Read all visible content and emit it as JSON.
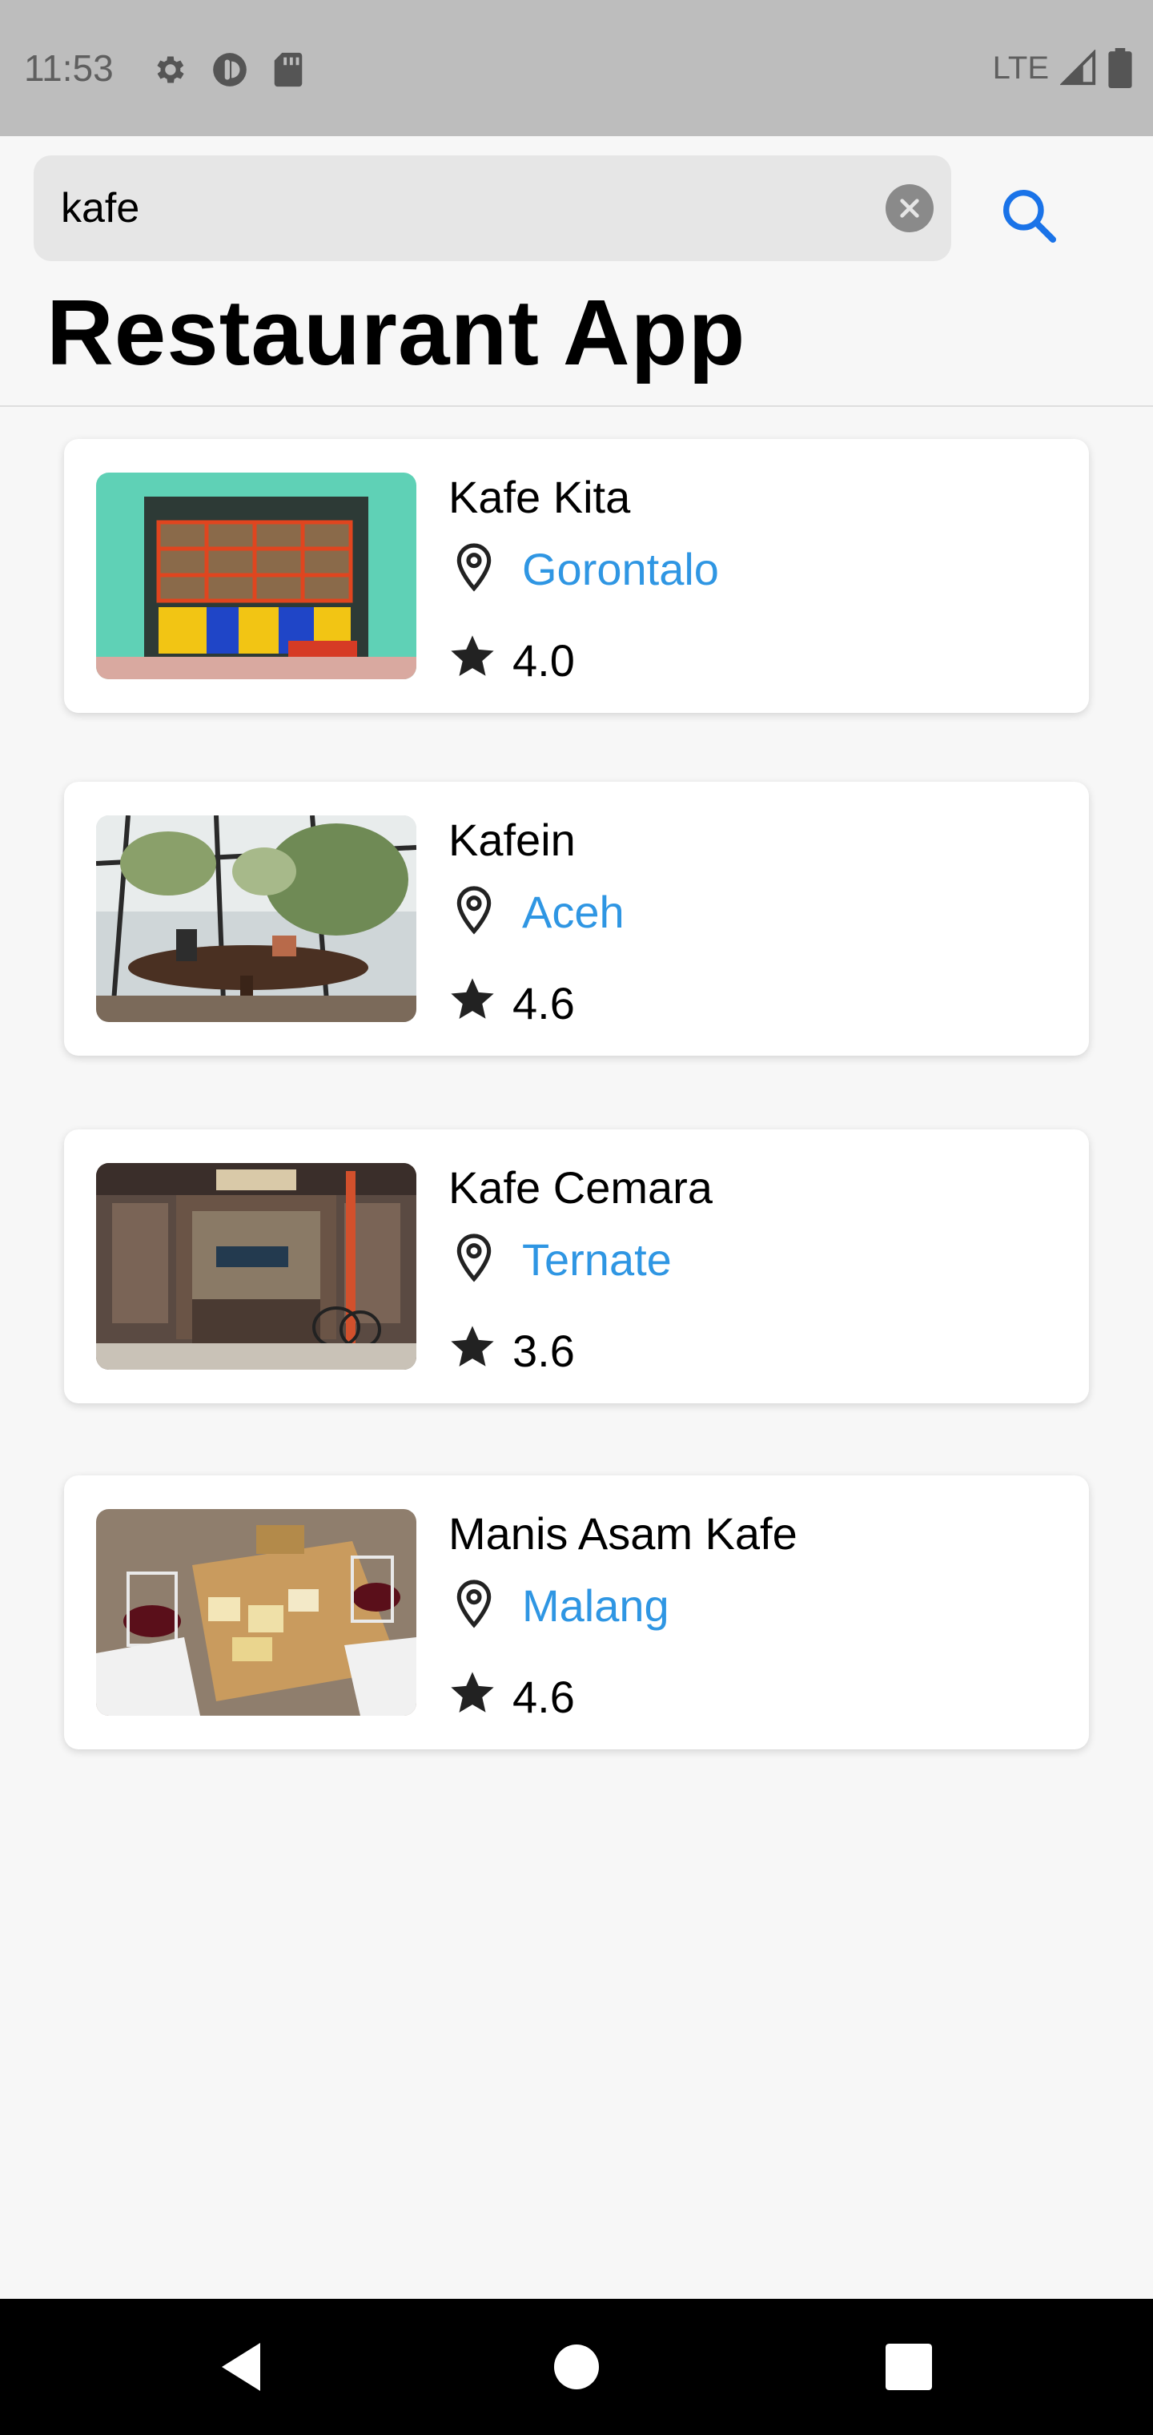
{
  "status_bar": {
    "time": "11:53",
    "network": "LTE",
    "icons": [
      "settings-icon",
      "vpn-key-icon",
      "sd-card-icon",
      "signal-icon",
      "battery-icon"
    ]
  },
  "search": {
    "query": "kafe",
    "clear_icon": "close-circle-icon",
    "search_icon": "search-icon"
  },
  "header": {
    "title": "Restaurant App"
  },
  "restaurants": [
    {
      "name": "Kafe Kita",
      "city": "Gorontalo",
      "rating": "4.0"
    },
    {
      "name": "Kafein",
      "city": "Aceh",
      "rating": "4.6"
    },
    {
      "name": "Kafe Cemara",
      "city": "Ternate",
      "rating": "3.6"
    },
    {
      "name": "Manis Asam Kafe",
      "city": "Malang",
      "rating": "4.6"
    }
  ],
  "colors": {
    "accent": "#2f96e3",
    "status_bar": "#bdbdbd",
    "nav_bar": "#000000"
  },
  "nav": {
    "icons": [
      "back-icon",
      "home-icon",
      "recents-icon"
    ]
  }
}
